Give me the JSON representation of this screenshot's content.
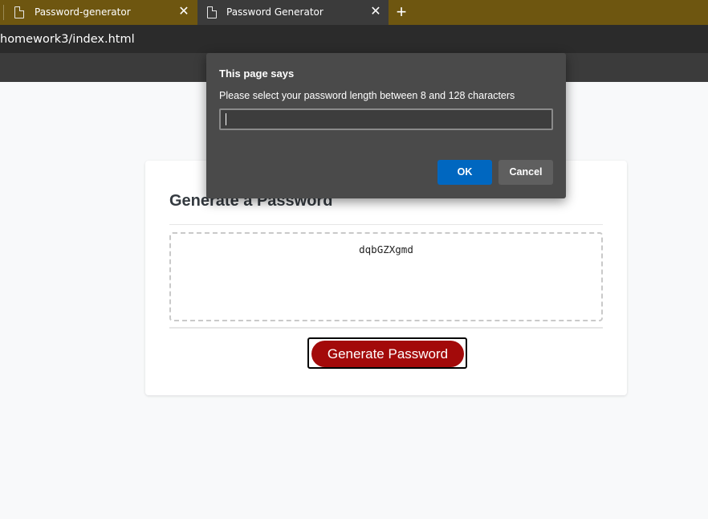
{
  "browser": {
    "tabs": [
      {
        "title": "Password-generator",
        "close": "✕",
        "icon": "document-icon"
      },
      {
        "title": "Password Generator",
        "close": "✕",
        "icon": "document-icon"
      }
    ],
    "new_tab": "+",
    "address": "homework3/index.html",
    "colors": {
      "tabstrip": "#6e5610",
      "active_tab": "#3b3b3b",
      "addressbar": "#2b2b2b"
    }
  },
  "page": {
    "heading": "Generate a Password",
    "password": "dqbGZXgmd",
    "generate_button": "Generate Password",
    "colors": {
      "button": "#a30a0a",
      "background": "#f8f9fa"
    }
  },
  "dialog": {
    "title": "This page says",
    "message": "Please select your password length between 8 and 128 characters",
    "input_value": "",
    "ok_label": "OK",
    "cancel_label": "Cancel",
    "colors": {
      "ok": "#0067c0",
      "cancel": "#5f5f5f",
      "background": "#4a4a4a"
    }
  }
}
